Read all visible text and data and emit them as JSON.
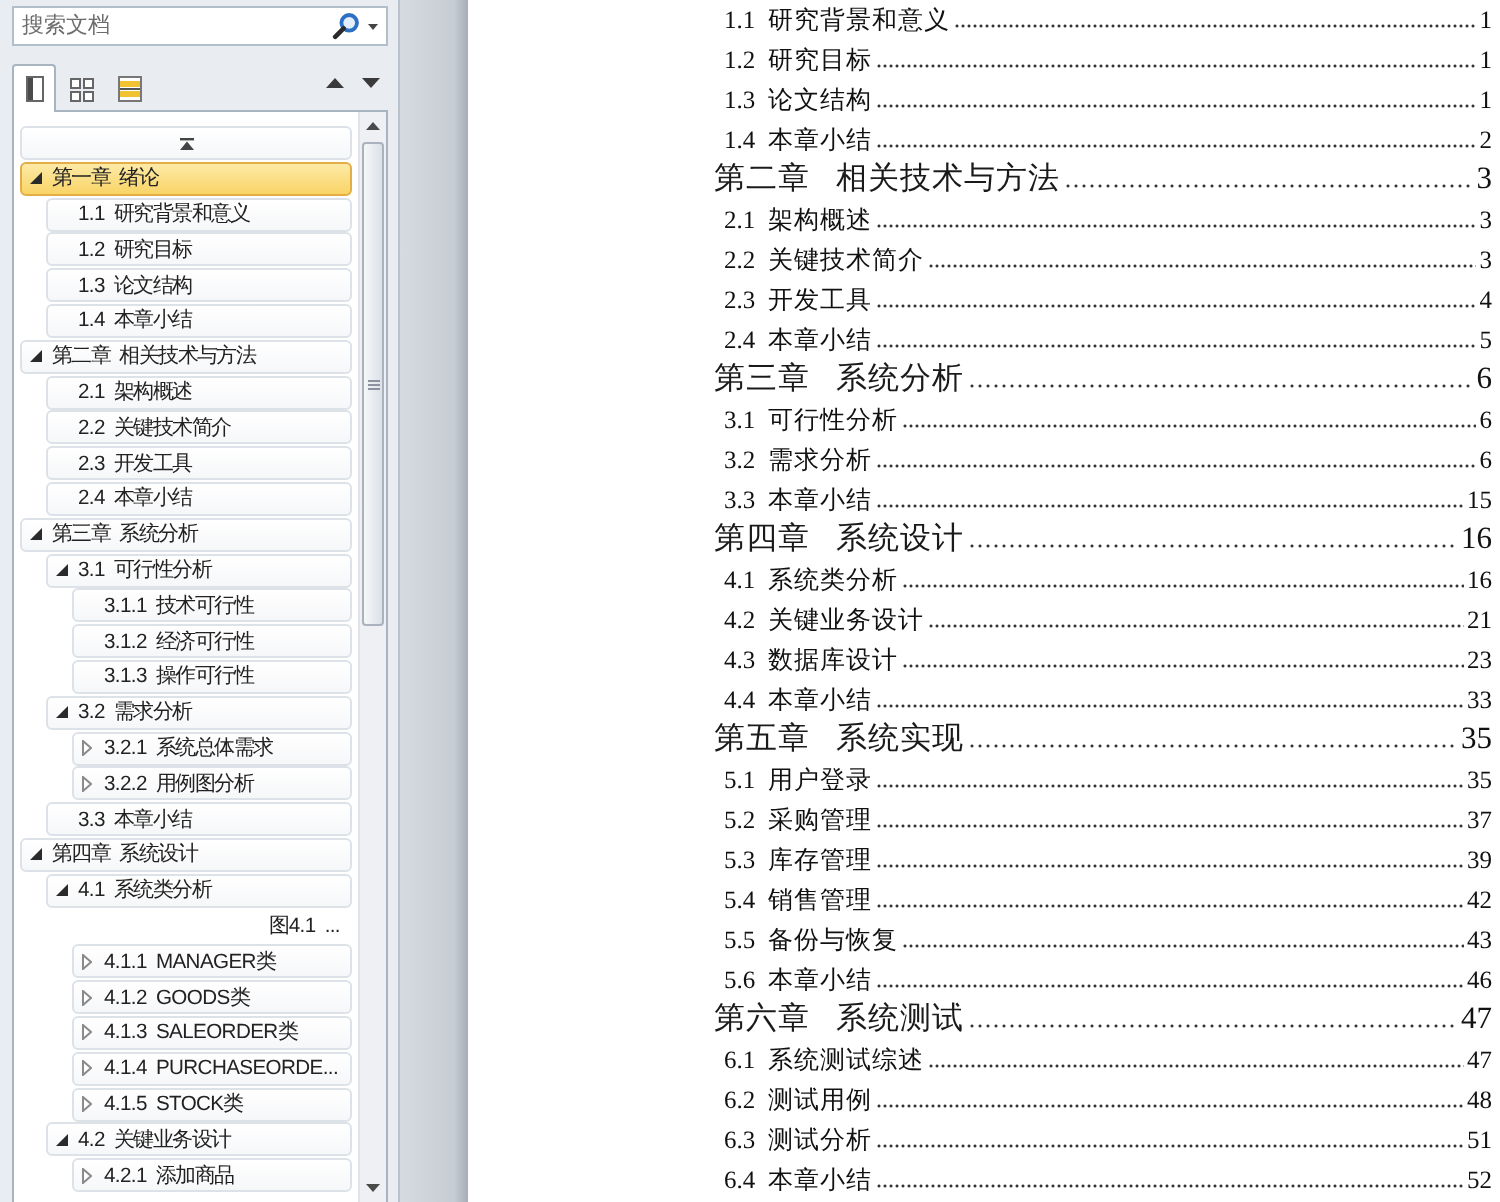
{
  "search": {
    "placeholder": "搜索文档"
  },
  "nav_tabs": [
    {
      "kind": "headings",
      "selected": true
    },
    {
      "kind": "pages",
      "selected": false
    },
    {
      "kind": "results",
      "selected": false
    }
  ],
  "navigation_tree": [
    {
      "label": "第一章 绪论",
      "expanded": true,
      "selected": true,
      "children": [
        {
          "label": "1.1 研究背景和意义",
          "selected": false
        },
        {
          "label": "1.2 研究目标",
          "selected": false
        },
        {
          "label": "1.3 论文结构",
          "selected": false
        },
        {
          "label": "1.4 本章小结",
          "selected": false
        }
      ]
    },
    {
      "label": "第二章 相关技术与方法",
      "expanded": true,
      "selected": false,
      "children": [
        {
          "label": "2.1 架构概述",
          "selected": false
        },
        {
          "label": "2.2 关键技术简介",
          "selected": false
        },
        {
          "label": "2.3 开发工具",
          "selected": false
        },
        {
          "label": "2.4 本章小结",
          "selected": false
        }
      ]
    },
    {
      "label": "第三章 系统分析",
      "expanded": true,
      "selected": false,
      "children": [
        {
          "label": "3.1 可行性分析",
          "expanded": true,
          "selected": false,
          "children": [
            {
              "label": "3.1.1 技术可行性",
              "selected": false
            },
            {
              "label": "3.1.2 经济可行性",
              "selected": false
            },
            {
              "label": "3.1.3 操作可行性",
              "selected": false
            }
          ]
        },
        {
          "label": "3.2 需求分析",
          "expanded": true,
          "selected": false,
          "children": [
            {
              "label": "3.2.1 系统总体需求",
              "expanded": false,
              "selected": false
            },
            {
              "label": "3.2.2 用例图分析",
              "expanded": false,
              "selected": false
            }
          ]
        },
        {
          "label": "3.3 本章小结",
          "selected": false
        }
      ]
    },
    {
      "label": "第四章 系统设计",
      "expanded": true,
      "selected": false,
      "children": [
        {
          "label": "4.1 系统类分析",
          "expanded": true,
          "selected": false,
          "children": [
            {
              "kind": "caption",
              "label": "图4.1 ...",
              "selected": false
            },
            {
              "kind": "heading",
              "label": "4.1.1 MANAGER类",
              "expanded": false,
              "selected": false
            },
            {
              "kind": "heading",
              "label": "4.1.2 GOODS类",
              "expanded": false,
              "selected": false
            },
            {
              "kind": "heading",
              "label": "4.1.3 SALEORDER类",
              "expanded": false,
              "selected": false
            },
            {
              "kind": "heading",
              "label": "4.1.4 PURCHASEORDE...",
              "expanded": false,
              "selected": false
            },
            {
              "kind": "heading",
              "label": "4.1.5 STOCK类",
              "expanded": false,
              "selected": false
            }
          ]
        },
        {
          "label": "4.2 关键业务设计",
          "expanded": true,
          "selected": false,
          "children": [
            {
              "label": "4.2.1 添加商品",
              "expanded": false,
              "selected": false
            }
          ]
        }
      ]
    }
  ],
  "table_of_contents": [
    {
      "children": [
        {
          "title": "1.1 研究背景和意义",
          "page": "1"
        },
        {
          "title": "1.2 研究目标",
          "page": "1"
        },
        {
          "title": "1.3 论文结构",
          "page": "1"
        },
        {
          "title": "1.4 本章小结",
          "page": "2"
        }
      ]
    },
    {
      "title": "第二章 相关技术与方法",
      "page": "3",
      "children": [
        {
          "title": "2.1 架构概述",
          "page": "3"
        },
        {
          "title": "2.2 关键技术简介",
          "page": "3"
        },
        {
          "title": "2.3 开发工具",
          "page": "4"
        },
        {
          "title": "2.4 本章小结",
          "page": "5"
        }
      ]
    },
    {
      "title": "第三章 系统分析",
      "page": "6",
      "children": [
        {
          "title": "3.1 可行性分析",
          "page": "6"
        },
        {
          "title": "3.2 需求分析",
          "page": "6"
        },
        {
          "title": "3.3 本章小结",
          "page": "15"
        }
      ]
    },
    {
      "title": "第四章 系统设计",
      "page": "16",
      "children": [
        {
          "title": "4.1 系统类分析",
          "page": "16"
        },
        {
          "title": "4.2 关键业务设计",
          "page": "21"
        },
        {
          "title": "4.3 数据库设计",
          "page": "23"
        },
        {
          "title": "4.4 本章小结",
          "page": "33"
        }
      ]
    },
    {
      "title": "第五章 系统实现",
      "page": "35",
      "children": [
        {
          "title": "5.1 用户登录",
          "page": "35"
        },
        {
          "title": "5.2 采购管理",
          "page": "37"
        },
        {
          "title": "5.3 库存管理",
          "page": "39"
        },
        {
          "title": "5.4 销售管理",
          "page": "42"
        },
        {
          "title": "5.5 备份与恢复",
          "page": "43"
        },
        {
          "title": "5.6 本章小结",
          "page": "46"
        }
      ]
    },
    {
      "title": "第六章 系统测试",
      "page": "47",
      "children": [
        {
          "title": "6.1 系统测试综述",
          "page": "47"
        },
        {
          "title": "6.2 测试用例",
          "page": "48"
        },
        {
          "title": "6.3 测试分析",
          "page": "51"
        },
        {
          "title": "6.4 本章小结",
          "page": "52"
        }
      ]
    }
  ]
}
